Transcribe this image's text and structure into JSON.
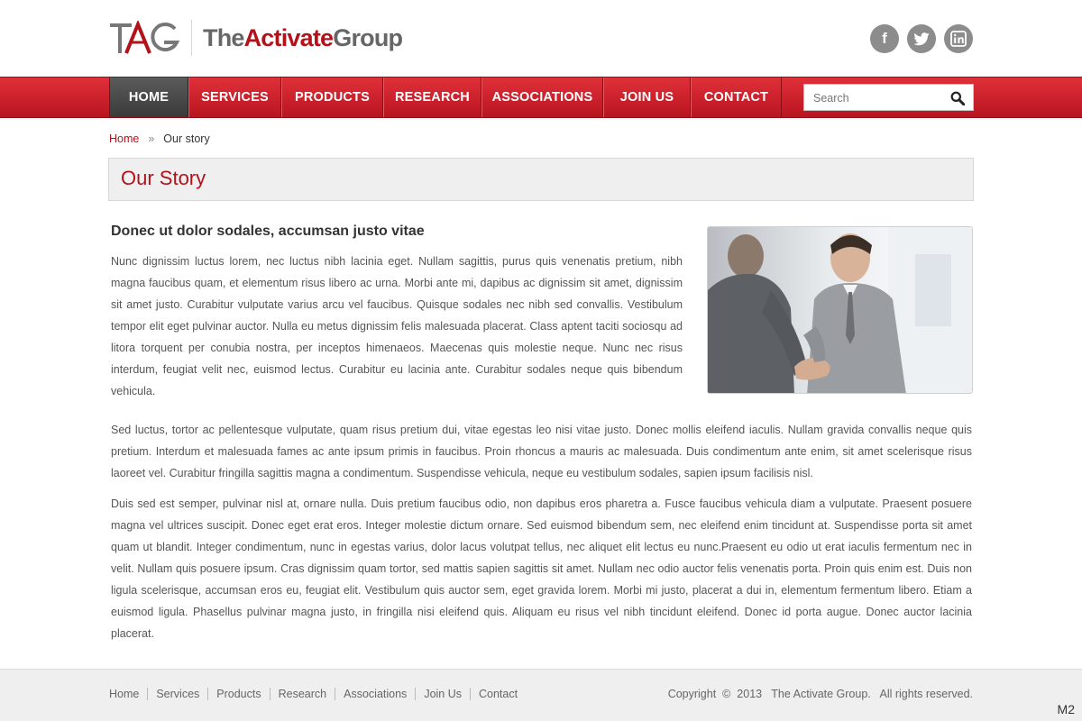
{
  "brand": {
    "mark": "TAG",
    "name_the": "The",
    "name_activate": "Activate",
    "name_group": "Group",
    "accent_color": "#b3121b"
  },
  "social": [
    {
      "name": "facebook-icon",
      "glyph": "f"
    },
    {
      "name": "twitter-icon",
      "glyph": "t"
    },
    {
      "name": "linkedin-icon",
      "glyph": "in"
    }
  ],
  "nav": {
    "items": [
      {
        "label": "HOME",
        "active": true
      },
      {
        "label": "SERVICES",
        "active": false
      },
      {
        "label": "PRODUCTS",
        "active": false
      },
      {
        "label": "RESEARCH",
        "active": false
      },
      {
        "label": "ASSOCIATIONS",
        "active": false
      },
      {
        "label": "JOIN US",
        "active": false
      },
      {
        "label": "CONTACT",
        "active": false
      }
    ],
    "search_placeholder": "Search"
  },
  "breadcrumb": {
    "home": "Home",
    "separator": "»",
    "current": "Our story"
  },
  "page_title": "Our Story",
  "content": {
    "subhead": "Donec ut dolor sodales, accumsan justo vitae",
    "p1": "Nunc dignissim luctus lorem, nec luctus nibh lacinia eget. Nullam sagittis, purus quis venenatis pretium, nibh magna faucibus quam, et elementum risus libero ac urna. Morbi ante mi, dapibus ac dignissim sit amet, dignissim sit amet justo. Curabitur vulputate varius arcu vel faucibus. Quisque sodales nec nibh sed convallis. Vestibulum tempor elit eget pulvinar auctor. Nulla eu metus dignissim felis malesuada placerat. Class aptent taciti sociosqu ad litora torquent per conubia nostra, per inceptos himenaeos. Maecenas quis molestie neque. Nunc nec risus interdum, feugiat velit nec, euismod lectus. Curabitur eu lacinia ante. Curabitur sodales neque quis bibendum vehicula.",
    "p2": "Sed luctus, tortor ac pellentesque vulputate, quam risus pretium dui, vitae egestas leo nisi vitae justo. Donec mollis eleifend iaculis. Nullam gravida convallis neque quis pretium. Interdum et malesuada fames ac ante ipsum primis in faucibus. Proin rhoncus a mauris ac malesuada. Duis condimentum ante enim, sit amet scelerisque risus laoreet vel. Curabitur fringilla sagittis magna a condimentum. Suspendisse vehicula, neque eu vestibulum sodales, sapien ipsum facilisis nisl.",
    "p3": "Duis sed est semper, pulvinar nisl at, ornare nulla. Duis pretium faucibus odio, non dapibus eros pharetra a. Fusce faucibus vehicula diam a vulputate. Praesent posuere magna vel ultrices suscipit. Donec eget erat eros. Integer molestie dictum ornare. Sed euismod bibendum sem, nec eleifend enim tincidunt at. Suspendisse porta sit amet quam ut blandit. Integer condimentum, nunc in egestas varius, dolor lacus volutpat tellus, nec aliquet elit lectus eu nunc.Praesent eu odio ut erat iaculis fermentum nec in velit. Nullam quis posuere ipsum. Cras dignissim quam tortor, sed mattis sapien sagittis sit amet. Nullam nec odio auctor felis venenatis porta. Proin quis enim est. Duis non ligula scelerisque, accumsan eros eu, feugiat elit. Vestibulum quis auctor sem, eget gravida lorem. Morbi mi justo, placerat a dui in, elementum fermentum libero. Etiam a euismod ligula. Phasellus pulvinar magna justo, in fringilla nisi eleifend quis. Aliquam eu risus vel nibh tincidunt eleifend. Donec id porta augue. Donec auctor lacinia placerat."
  },
  "footer": {
    "links": [
      "Home",
      "Services",
      "Products",
      "Research",
      "Associations",
      "Join Us",
      "Contact"
    ],
    "copyright": "Copyright  ©  2013   The Activate Group.   All rights reserved."
  },
  "corner_label": "M2"
}
